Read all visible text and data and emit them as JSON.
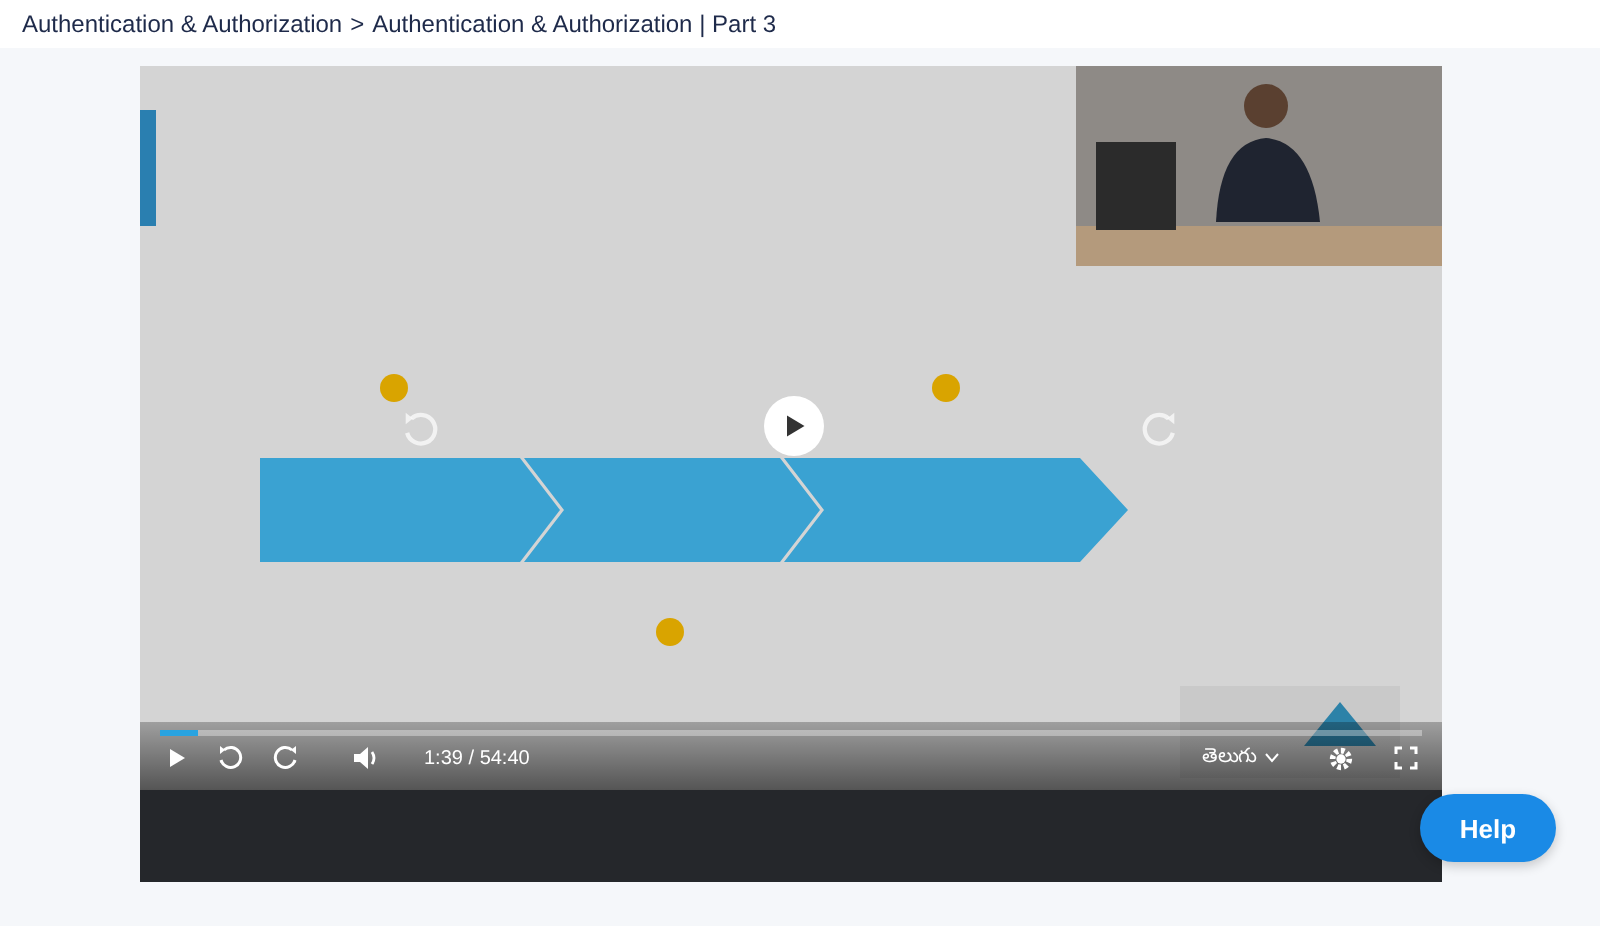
{
  "breadcrumb": {
    "items": [
      {
        "label": "Authentication & Authorization"
      },
      {
        "label": "Authentication & Authorization | Part 3"
      }
    ],
    "separator": ">"
  },
  "player": {
    "playing": false,
    "progress": {
      "level": 0.03
    },
    "time": {
      "current": "1:39",
      "separator": "/",
      "total": "54:40"
    },
    "language": "తెలుగు"
  },
  "help_button": {
    "label": "Help"
  }
}
